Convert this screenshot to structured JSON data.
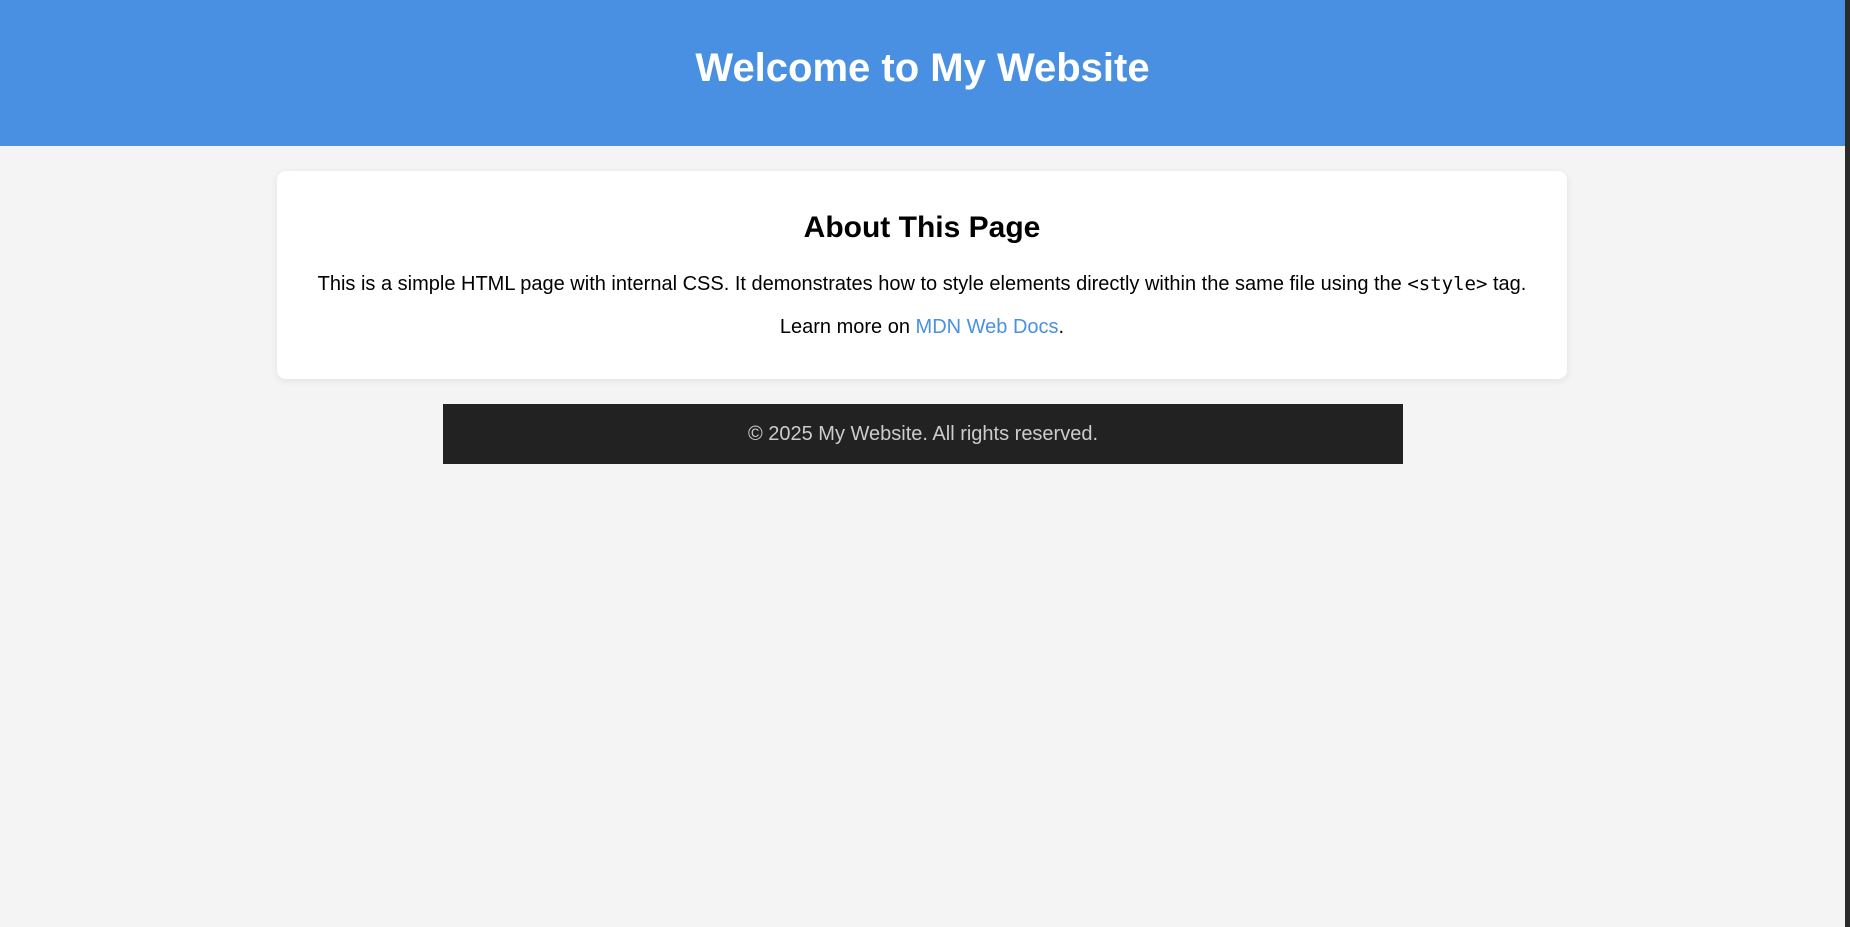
{
  "header": {
    "title": "Welcome to My Website"
  },
  "main": {
    "heading": "About This Page",
    "intro_before_code": "This is a simple HTML page with internal CSS. It demonstrates how to style elements directly within the same file using the ",
    "code_text": "<style>",
    "intro_after_code": " tag.",
    "learn_prefix": "Learn more on ",
    "link_label": "MDN Web Docs",
    "learn_suffix": "."
  },
  "footer": {
    "text": "© 2025 My Website. All rights reserved."
  },
  "colors": {
    "header_bg": "#4a90e2",
    "page_bg": "#f4f4f4",
    "card_bg": "#ffffff",
    "link": "#4a90e2",
    "footer_bg": "#222222",
    "footer_text": "#cccccc"
  }
}
